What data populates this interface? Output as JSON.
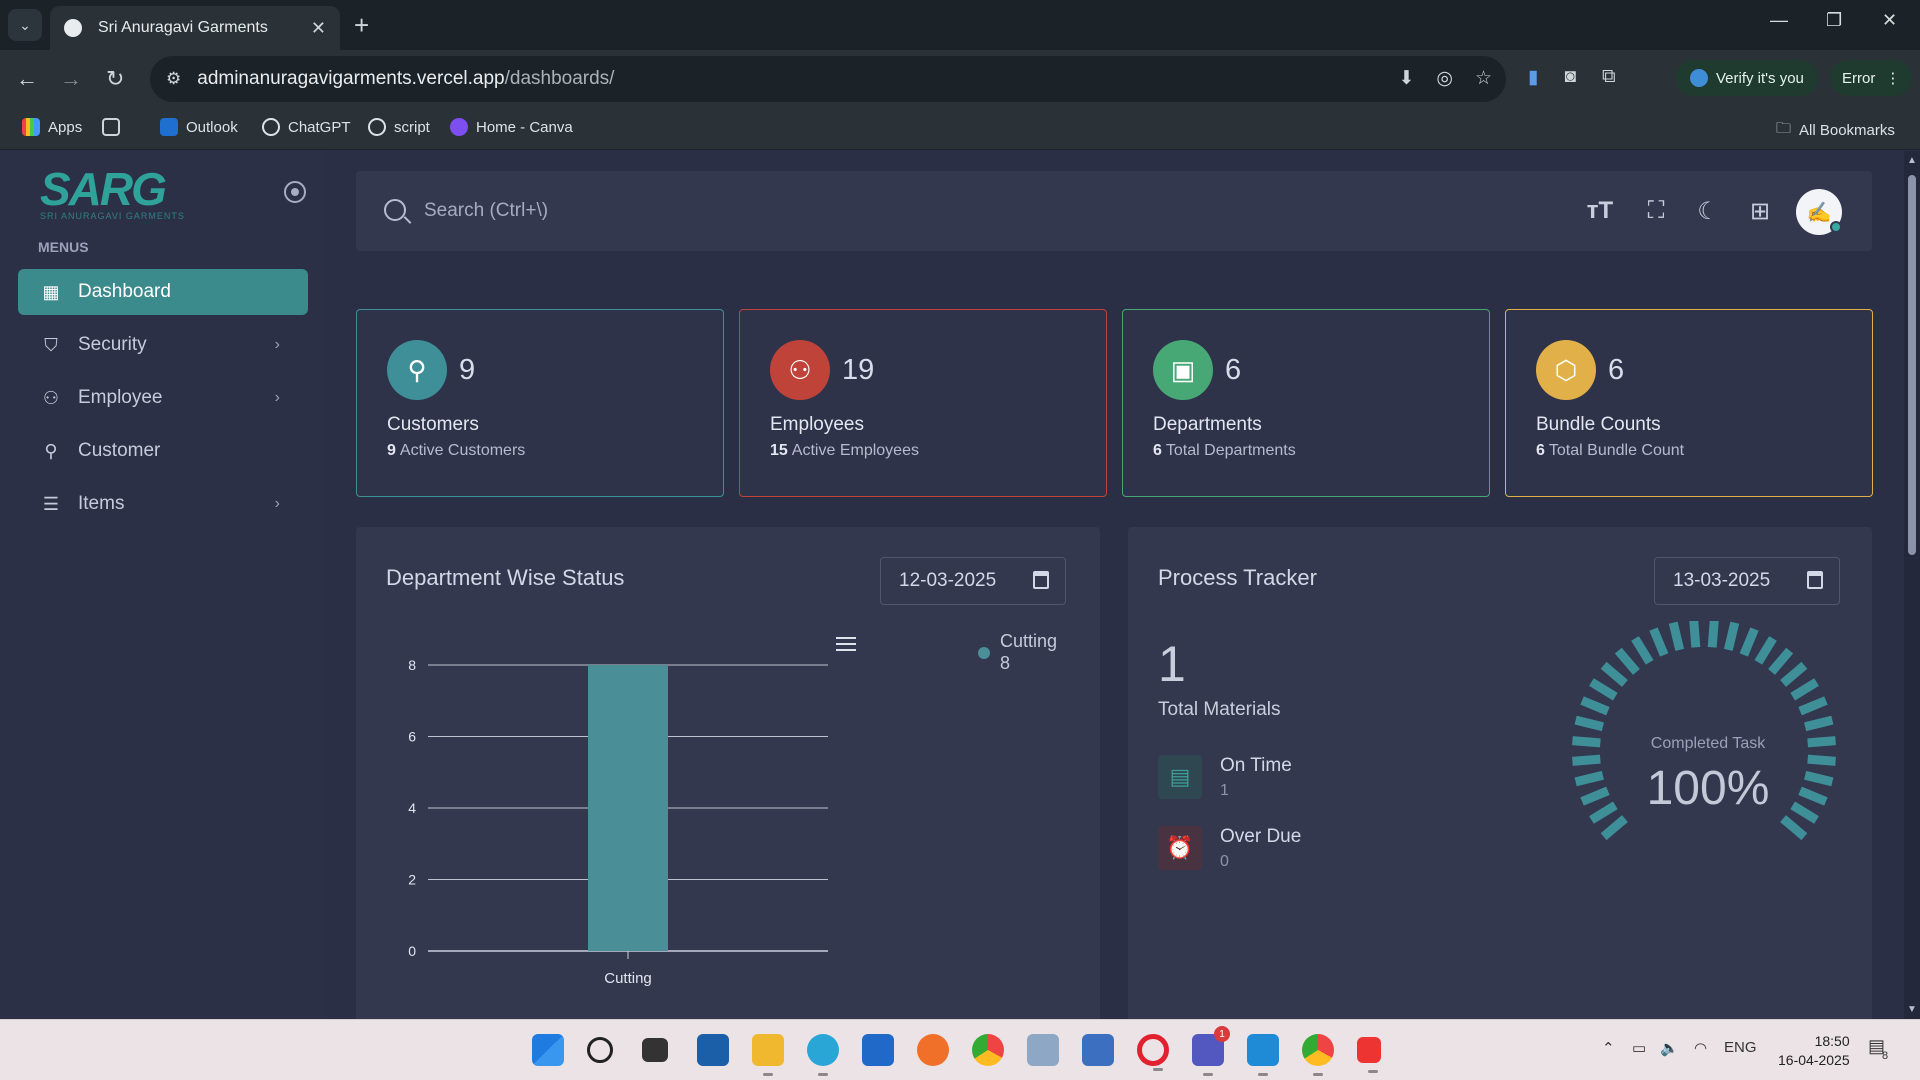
{
  "browser": {
    "tab_title": "Sri Anuragavi Garments",
    "url_host": "adminanuragavigarments.vercel.app",
    "url_path": "/dashboards/",
    "verify_label": "Verify it's you",
    "error_label": "Error",
    "bookmarks": [
      "Apps",
      "Outlook",
      "ChatGPT",
      "script",
      "Home - Canva"
    ],
    "all_bookmarks": "All Bookmarks"
  },
  "sidebar": {
    "logo": "SARG",
    "logo_sub": "SRI ANURAGAVI GARMENTS",
    "menus_label": "MENUS",
    "items": [
      {
        "label": "Dashboard",
        "icon": "grid-icon",
        "active": true,
        "has_children": false
      },
      {
        "label": "Security",
        "icon": "shield-icon",
        "active": false,
        "has_children": true
      },
      {
        "label": "Employee",
        "icon": "users-icon",
        "active": false,
        "has_children": true
      },
      {
        "label": "Customer",
        "icon": "user-icon",
        "active": false,
        "has_children": false
      },
      {
        "label": "Items",
        "icon": "list-icon",
        "active": false,
        "has_children": true
      }
    ]
  },
  "topbar": {
    "search_placeholder": "Search (Ctrl+\\)"
  },
  "stats": [
    {
      "value": "9",
      "label": "Customers",
      "sub_value": "9",
      "sub_label": "Active Customers",
      "color": "#3f8f98",
      "icon": "user-icon"
    },
    {
      "value": "19",
      "label": "Employees",
      "sub_value": "15",
      "sub_label": "Active Employees",
      "color": "#c0433a",
      "icon": "users-icon"
    },
    {
      "value": "6",
      "label": "Departments",
      "sub_value": "6",
      "sub_label": "Total Departments",
      "color": "#47a876",
      "icon": "department-icon"
    },
    {
      "value": "6",
      "label": "Bundle Counts",
      "sub_value": "6",
      "sub_label": "Total Bundle Count",
      "color": "#e1b048",
      "icon": "box-icon"
    }
  ],
  "department_panel": {
    "title": "Department Wise Status",
    "date": "12-03-2025",
    "legend": [
      {
        "name": "Cutting",
        "value": "8"
      }
    ]
  },
  "chart_data": {
    "type": "bar",
    "categories": [
      "Cutting"
    ],
    "values": [
      8
    ],
    "title": "Department Wise Status",
    "xlabel": "",
    "ylabel": "",
    "ylim": [
      0,
      8
    ],
    "yticks": [
      0,
      2,
      4,
      6,
      8
    ],
    "grid": true,
    "legend": "right",
    "color": "#4a8e98"
  },
  "process_panel": {
    "title": "Process Tracker",
    "date": "13-03-2025",
    "total_value": "1",
    "total_label": "Total Materials",
    "on_time_label": "On Time",
    "on_time_value": "1",
    "over_due_label": "Over Due",
    "over_due_value": "0",
    "gauge_label": "Completed Task",
    "gauge_value": "100%",
    "gauge_fraction": 1.0,
    "gauge_color": "#3f8f98"
  },
  "taskbar": {
    "language": "ENG",
    "time": "18:50",
    "date": "16-04-2025",
    "teams_badge": "1",
    "notification_count": "8"
  }
}
